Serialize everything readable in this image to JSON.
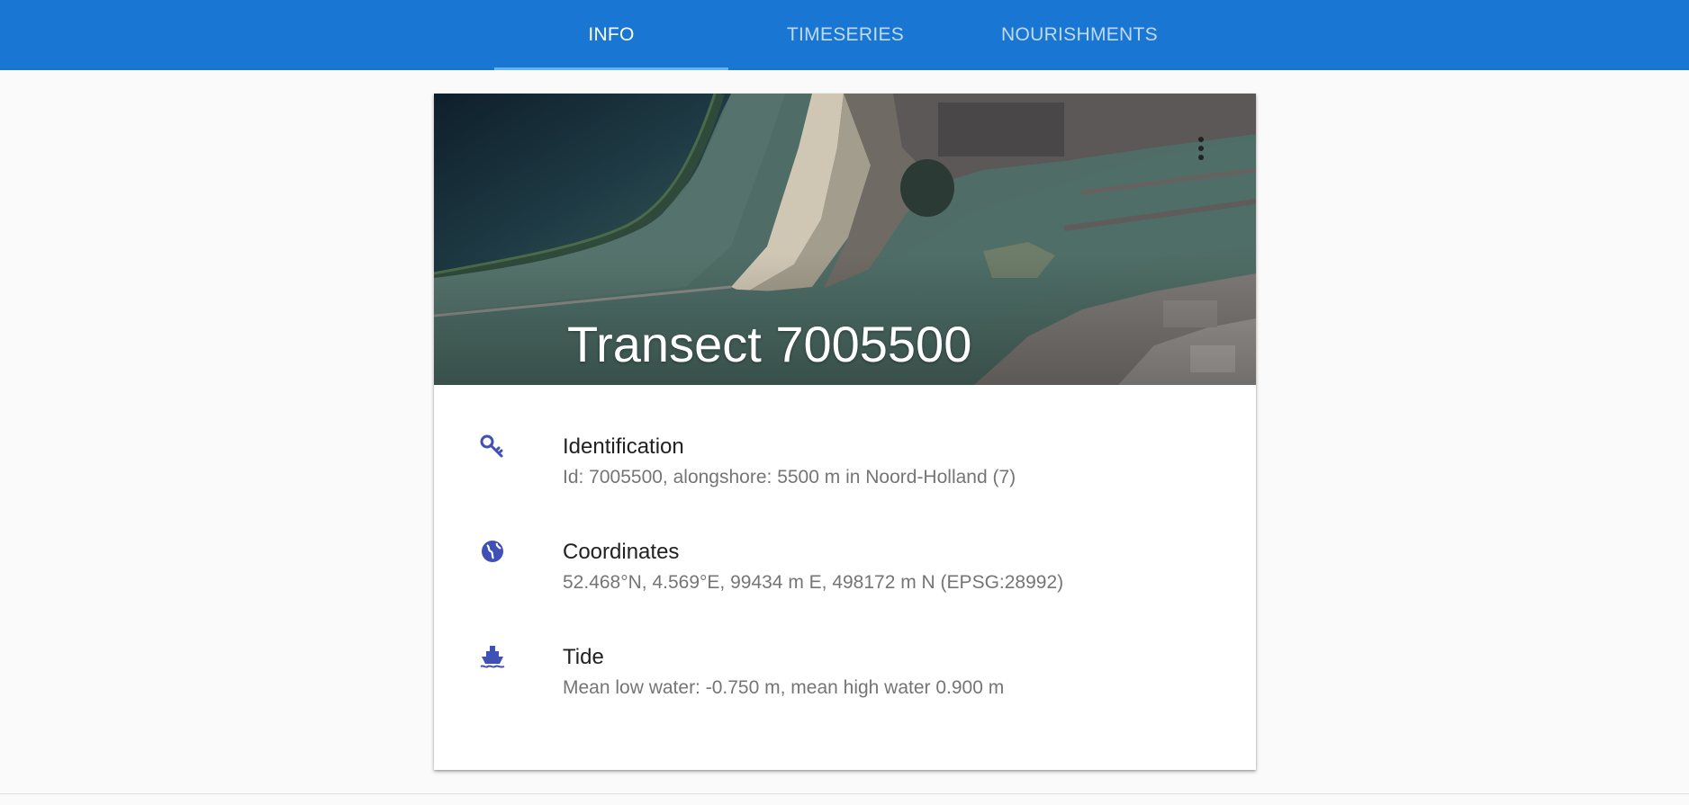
{
  "tabs": [
    {
      "label": "INFO",
      "active": true
    },
    {
      "label": "TIMESERIES",
      "active": false
    },
    {
      "label": "NOURISHMENTS",
      "active": false
    }
  ],
  "card": {
    "title": "Transect 7005500",
    "menu_icon": "more-vert-icon",
    "rows": [
      {
        "icon": "key-icon",
        "title": "Identification",
        "text": "Id: 7005500, alongshore: 5500 m in Noord-Holland (7)"
      },
      {
        "icon": "globe-icon",
        "title": "Coordinates",
        "text": "52.468°N, 4.569°E, 99434 m E, 498172 m N (EPSG:28992)"
      },
      {
        "icon": "ship-icon",
        "title": "Tide",
        "text": "Mean low water: -0.750 m, mean high water 0.900 m"
      }
    ]
  },
  "colors": {
    "appbar": "#1976d2",
    "tab_indicator": "#64b5f6",
    "icon": "#3f51b5",
    "title_text": "#212121",
    "secondary_text": "#757575"
  }
}
